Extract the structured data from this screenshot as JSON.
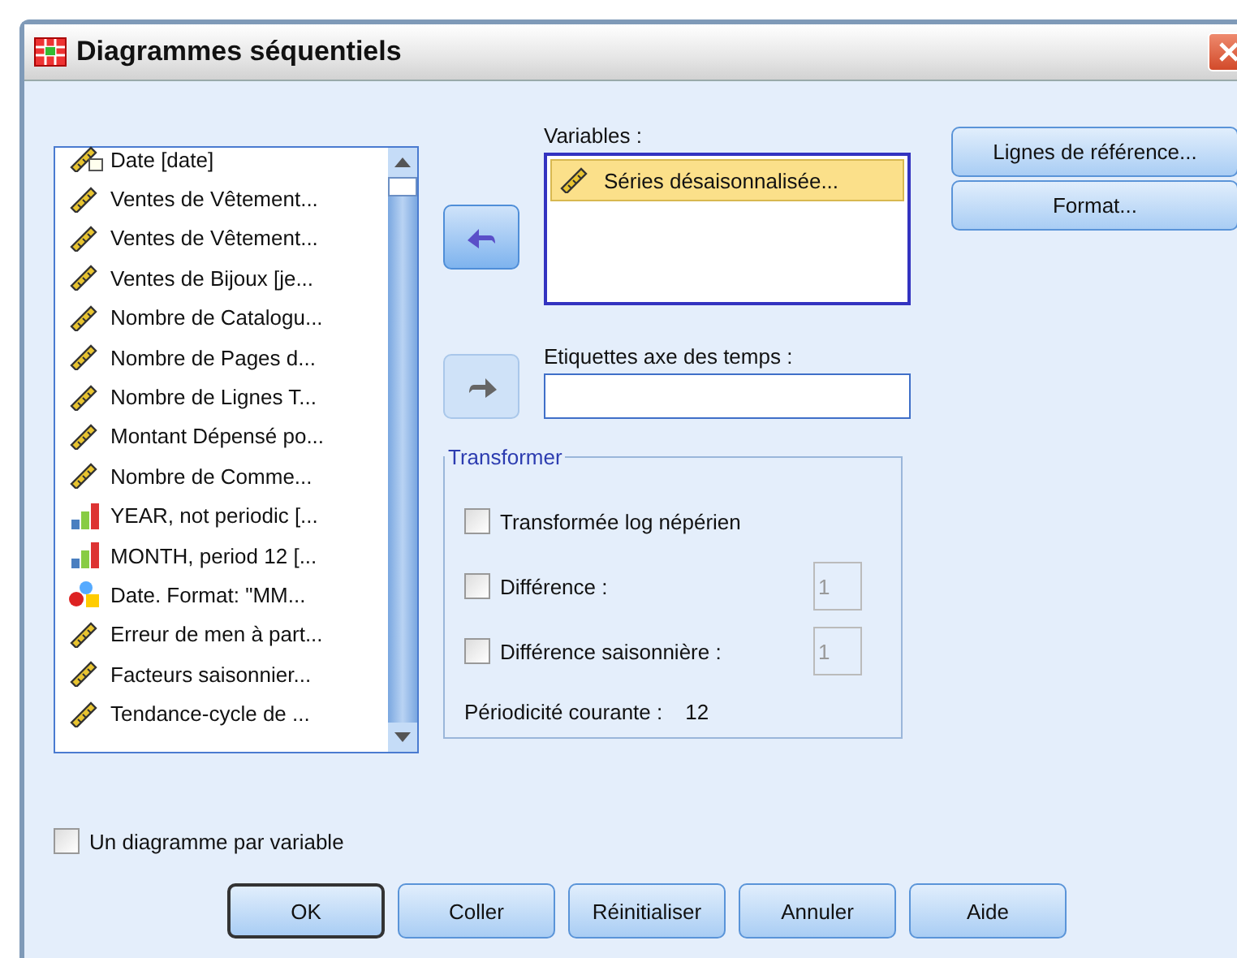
{
  "window": {
    "title": "Diagrammes séquentiels"
  },
  "source_list": {
    "items": [
      {
        "label": "Date [date]",
        "kind": "date",
        "selected": false
      },
      {
        "label": "Ventes de Vêtement...",
        "kind": "scale",
        "selected": false
      },
      {
        "label": "Ventes de Vêtement...",
        "kind": "scale",
        "selected": false
      },
      {
        "label": "Ventes de Bijoux [je...",
        "kind": "scale",
        "selected": false
      },
      {
        "label": "Nombre de Catalogu...",
        "kind": "scale",
        "selected": false
      },
      {
        "label": "Nombre de Pages d...",
        "kind": "scale",
        "selected": false
      },
      {
        "label": "Nombre de Lignes T...",
        "kind": "scale",
        "selected": false
      },
      {
        "label": "Montant Dépensé po...",
        "kind": "scale",
        "selected": false
      },
      {
        "label": "Nombre de Comme...",
        "kind": "scale",
        "selected": false
      },
      {
        "label": "YEAR, not periodic [...",
        "kind": "ordinal",
        "selected": false
      },
      {
        "label": "MONTH, period 12 [...",
        "kind": "ordinal",
        "selected": false
      },
      {
        "label": "Date.  Format:  \"MM...",
        "kind": "nominal",
        "selected": false
      },
      {
        "label": "Erreur de men à part...",
        "kind": "scale",
        "selected": false
      },
      {
        "label": "Facteurs saisonnier...",
        "kind": "scale",
        "selected": false
      },
      {
        "label": "Tendance-cycle de ...",
        "kind": "scale",
        "selected": false
      }
    ]
  },
  "move_buttons": [
    {
      "kind": "left",
      "disabled": false
    },
    {
      "kind": "right",
      "disabled": true
    }
  ],
  "variables": {
    "label": "Variables :",
    "items": [
      {
        "label": "Séries désaisonnalisée...",
        "kind": "scale",
        "selected": true
      }
    ]
  },
  "time_axis_labels": {
    "label": "Etiquettes axe des temps :"
  },
  "transform": {
    "title": "Transformer",
    "options": [
      {
        "label": "Transformée log népérien",
        "checked": false
      },
      {
        "label": "Différence :",
        "checked": false,
        "value": "1",
        "disabled": true
      },
      {
        "label": "Différence saisonnière :",
        "checked": false,
        "value": "1",
        "disabled": true
      }
    ],
    "periodicity_label": "Périodicité courante :",
    "periodicity_value": "12"
  },
  "side_buttons": [
    "Lignes de référence...",
    "Format..."
  ],
  "one_chart_per_variable": {
    "label": "Un diagramme par variable",
    "checked": false
  },
  "buttons": [
    "OK",
    "Coller",
    "Réinitialiser",
    "Annuler",
    "Aide"
  ]
}
